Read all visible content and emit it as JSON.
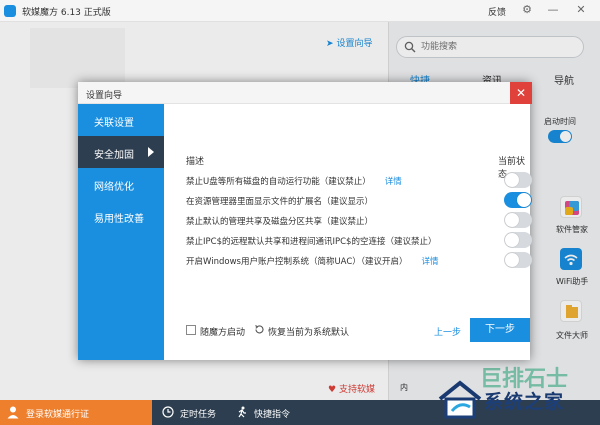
{
  "app": {
    "title": "软媒魔方 6.13 正式版",
    "feedback": "反馈"
  },
  "main": {
    "wizard_link": "设置向导",
    "support": "支持软媒",
    "fragment": "内"
  },
  "right_panel": {
    "search_placeholder": "功能搜索",
    "tabs": [
      {
        "label": "快捷",
        "active": true
      },
      {
        "label": "资讯",
        "active": false
      },
      {
        "label": "导航",
        "active": false
      }
    ],
    "boot_label": "启动时间",
    "tools": [
      {
        "label": "软件管家",
        "icon": "software-manager-icon"
      },
      {
        "label": "WiFi助手",
        "icon": "wifi-icon"
      },
      {
        "label": "文件大师",
        "icon": "file-master-icon"
      }
    ]
  },
  "bottombar": {
    "login": "登录软媒通行证",
    "timer": "定时任务",
    "shortcut": "快捷指令"
  },
  "watermark": {
    "text": "系统之家",
    "ghost": "巨排石士"
  },
  "dialog": {
    "title": "设置向导",
    "sidebar": [
      {
        "label": "关联设置",
        "active": false
      },
      {
        "label": "安全加固",
        "active": true
      },
      {
        "label": "网络优化",
        "active": false
      },
      {
        "label": "易用性改善",
        "active": false
      }
    ],
    "header_desc": "描述",
    "header_state": "当前状态",
    "options": [
      {
        "text": "禁止U盘等所有磁盘的自动运行功能（建议禁止）",
        "detail": "详情",
        "on": false
      },
      {
        "text": "在资源管理器里面显示文件的扩展名（建议显示）",
        "detail": "",
        "on": true
      },
      {
        "text": "禁止默认的管理共享及磁盘分区共享（建议禁止）",
        "detail": "",
        "on": false
      },
      {
        "text": "禁止IPC$的远程默认共享和进程间通讯IPC$的空连接（建议禁止）",
        "detail": "",
        "on": false
      },
      {
        "text": "开启Windows用户账户控制系统（简称UAC）（建议开启）",
        "detail": "详情",
        "on": false
      }
    ],
    "auto_start": "随魔方启动",
    "restore": "恢复当前为系统默认",
    "prev": "上一步",
    "next": "下一步"
  },
  "colors": {
    "accent": "#1a8fe0",
    "sidebar_active": "#2d3e50",
    "login_orange": "#ee7f2d",
    "close_red": "#e0413a"
  }
}
